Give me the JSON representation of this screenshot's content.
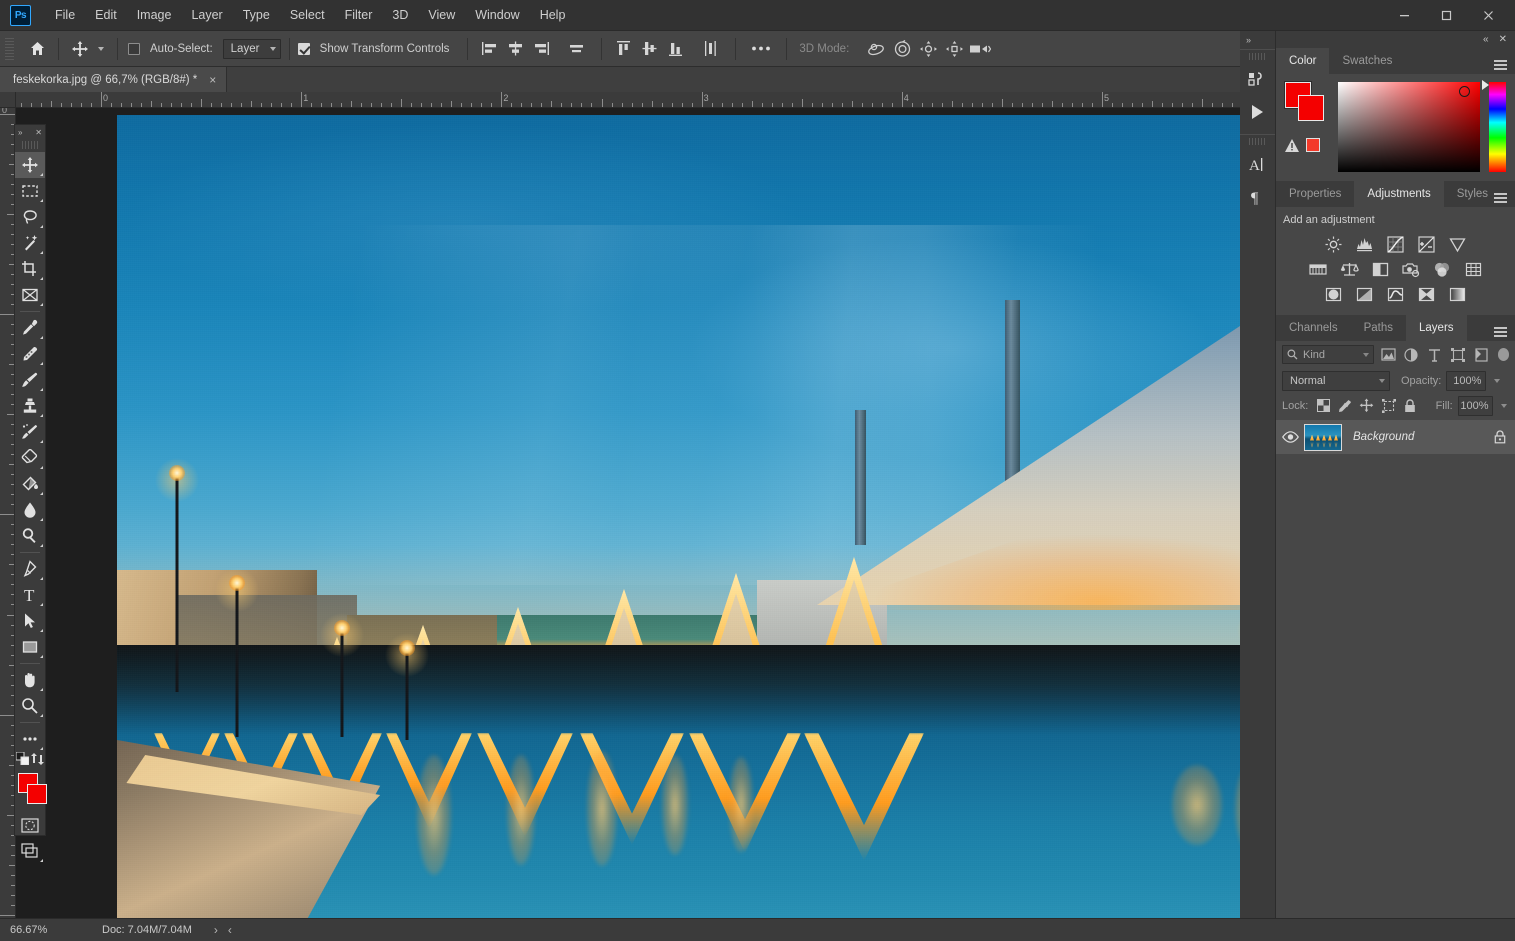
{
  "app": {
    "name": "Photoshop",
    "logo_text": "Ps"
  },
  "menubar": {
    "items": [
      {
        "label": "File",
        "accel": "F"
      },
      {
        "label": "Edit",
        "accel": "E"
      },
      {
        "label": "Image",
        "accel": "I"
      },
      {
        "label": "Layer",
        "accel": "L"
      },
      {
        "label": "Type",
        "accel": "y"
      },
      {
        "label": "Select",
        "accel": "S"
      },
      {
        "label": "Filter",
        "accel": "t"
      },
      {
        "label": "3D",
        "accel": "D"
      },
      {
        "label": "View",
        "accel": "V"
      },
      {
        "label": "Window",
        "accel": "W"
      },
      {
        "label": "Help",
        "accel": "H"
      }
    ]
  },
  "window_controls": {
    "minimize": "minimize-icon",
    "maximize": "maximize-icon",
    "close": "close-icon"
  },
  "options_bar": {
    "home_icon": "home-icon",
    "tool_icon": "move-tool-icon",
    "auto_select_label": "Auto-Select:",
    "auto_select_checked": false,
    "auto_select_scope": "Layer",
    "show_transform_label": "Show Transform Controls",
    "show_transform_checked": true,
    "align_icons": [
      "align-left-edges-icon",
      "align-horizontal-centers-icon",
      "align-right-edges-icon",
      "distribute-horizontal-icon"
    ],
    "align_icons_2": [
      "align-top-edges-icon",
      "align-vertical-centers-icon",
      "align-bottom-edges-icon",
      "distribute-vertical-icon"
    ],
    "more_icon": "more-options-icon",
    "three_d_mode_label": "3D Mode:",
    "three_d_icons": [
      "rotate-3d-icon",
      "roll-3d-icon",
      "drag-3d-icon",
      "slide-3d-icon",
      "scale-3d-icon"
    ]
  },
  "document_tab": {
    "title": "feskekorka.jpg @ 66,7% (RGB/8#) *",
    "close": "×"
  },
  "rulers": {
    "horizontal_labels": [
      "0",
      "1",
      "2",
      "3",
      "4",
      "5"
    ],
    "vertical_labels": [
      "0"
    ]
  },
  "toolbar": {
    "collapse_icon": "collapse-panel-icon",
    "close_icon": "close-icon",
    "tools": [
      {
        "name": "move-tool",
        "active": true
      },
      {
        "name": "rectangular-marquee-tool",
        "active": false
      },
      {
        "name": "lasso-tool",
        "active": false
      },
      {
        "name": "magic-wand-tool",
        "active": false
      },
      {
        "name": "crop-tool",
        "active": false
      },
      {
        "name": "frame-tool",
        "active": false
      },
      {
        "name": "eyedropper-tool",
        "active": false
      },
      {
        "name": "spot-healing-brush-tool",
        "active": false
      },
      {
        "name": "brush-tool",
        "active": false
      },
      {
        "name": "clone-stamp-tool",
        "active": false
      },
      {
        "name": "history-brush-tool",
        "active": false
      },
      {
        "name": "eraser-tool",
        "active": false
      },
      {
        "name": "gradient-tool",
        "active": false
      },
      {
        "name": "blur-tool",
        "active": false
      },
      {
        "name": "dodge-tool",
        "active": false
      },
      {
        "name": "pen-tool",
        "active": false
      },
      {
        "name": "horizontal-type-tool",
        "active": false
      },
      {
        "name": "path-selection-tool",
        "active": false
      },
      {
        "name": "rectangle-tool",
        "active": false
      },
      {
        "name": "hand-tool",
        "active": false
      },
      {
        "name": "zoom-tool",
        "active": false
      },
      {
        "name": "edit-toolbar-tool",
        "active": false
      }
    ],
    "default_colors_icon": "default-colors-icon",
    "swap_colors_icon": "swap-colors-icon",
    "foreground_color": "#f40000",
    "background_color": "#f40000",
    "quick_mask_icon": "quick-mask-icon",
    "screen_mode_icon": "screen-mode-icon"
  },
  "dock_strip": {
    "expand_icon": "expand-panels-icon",
    "buttons": [
      {
        "name": "libraries-icon"
      },
      {
        "name": "actions-play-icon"
      },
      {
        "name": "character-panel-icon"
      },
      {
        "name": "paragraph-panel-icon"
      }
    ]
  },
  "panels": {
    "topbar": {
      "collapse": "collapse-icon",
      "close": "close-icon"
    },
    "color_group": {
      "tabs": [
        {
          "label": "Color",
          "active": true
        },
        {
          "label": "Swatches",
          "active": false
        }
      ],
      "menu_icon": "panel-menu-icon",
      "foreground_color": "#f40000",
      "background_color": "#f40000",
      "out_of_gamut_icon": "gamut-warning-icon",
      "gamut_swatch_color": "#f33a2a"
    },
    "adjustments_group": {
      "tabs": [
        {
          "label": "Properties",
          "active": false
        },
        {
          "label": "Adjustments",
          "active": true
        },
        {
          "label": "Styles",
          "active": false
        }
      ],
      "menu_icon": "panel-menu-icon",
      "title": "Add an adjustment",
      "row1": [
        "brightness-contrast-icon",
        "levels-icon",
        "curves-icon",
        "exposure-icon",
        "vibrance-icon"
      ],
      "row2": [
        "hue-saturation-icon",
        "color-balance-icon",
        "black-white-icon",
        "photo-filter-icon",
        "channel-mixer-icon",
        "color-lookup-icon"
      ],
      "row3": [
        "invert-icon",
        "posterize-icon",
        "threshold-icon",
        "selective-color-icon",
        "gradient-map-icon"
      ]
    },
    "layers_group": {
      "tabs": [
        {
          "label": "Channels",
          "active": false
        },
        {
          "label": "Paths",
          "active": false
        },
        {
          "label": "Layers",
          "active": true
        }
      ],
      "menu_icon": "panel-menu-icon",
      "filter": {
        "search_icon": "search-icon",
        "kind_label": "Kind",
        "type_icons": [
          "filter-pixel-icon",
          "filter-adjustment-icon",
          "filter-type-icon",
          "filter-shape-icon",
          "filter-smart-object-icon"
        ],
        "toggle_icon": "filter-toggle-icon"
      },
      "blend_mode": "Normal",
      "opacity_label": "Opacity:",
      "opacity_value": "100%",
      "lock_label": "Lock:",
      "lock_icons": [
        "lock-transparent-pixels-icon",
        "lock-image-pixels-icon",
        "lock-position-icon",
        "lock-artboard-nesting-icon",
        "lock-all-icon"
      ],
      "fill_label": "Fill:",
      "fill_value": "100%",
      "layers": [
        {
          "name": "Background",
          "visible": true,
          "locked": true,
          "eye_icon": "eye-icon",
          "lock_icon": "lock-icon"
        }
      ]
    }
  },
  "status_bar": {
    "zoom": "66,67%",
    "doc_info": "Doc: 7,04M/7,04M",
    "next_arrow": "›",
    "prev_arrow": "‹"
  },
  "canvas": {
    "image_title": "Feskekörka fish market church at blue hour with canal reflections",
    "background_color": "#1e1e1e"
  },
  "colors": {
    "titlebar_bg": "#323232",
    "options_bar_bg": "#454545",
    "panel_bg": "#474747",
    "panel_tab_bg": "#3b3b3b",
    "canvas_bg": "#1e1e1e",
    "accent_blue": "#31a8ff",
    "text_primary": "#d9d9d9",
    "text_dim": "#8a8a8a",
    "layer_selected_bg": "#585858"
  }
}
